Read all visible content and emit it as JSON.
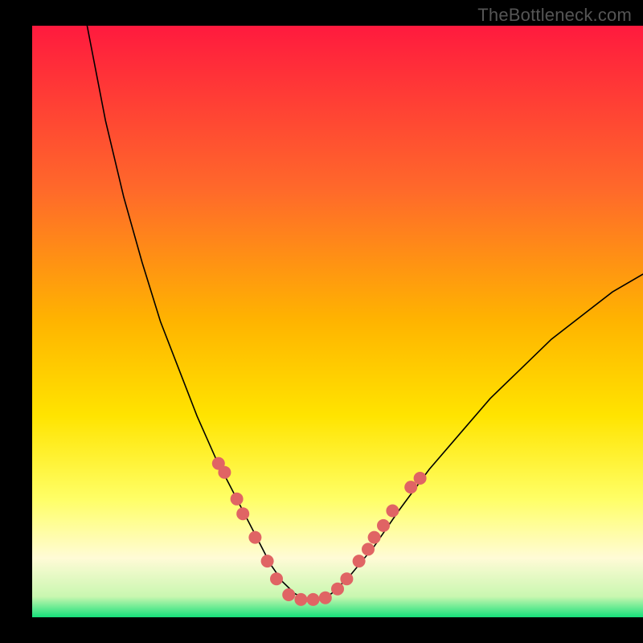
{
  "watermark": "TheBottleneck.com",
  "chart_data": {
    "type": "line",
    "title": "",
    "xlabel": "",
    "ylabel": "",
    "xlim": [
      0,
      100
    ],
    "ylim": [
      0,
      100
    ],
    "background_gradient": {
      "top": "#ff1a3e",
      "mid_upper": "#ff8a2a",
      "mid": "#ffd400",
      "mid_lower": "#ffff66",
      "cream": "#fffbd6",
      "bottom": "#15e07a"
    },
    "notes": "V-shaped curve with minimum around x≈42–48; left arm starts near top at x≈9 y≈100; right arm reaches x≈100 at y≈58. Salmon bead markers along lower portions of both arms and a short horizontal run at the floor.",
    "series": [
      {
        "name": "curve",
        "color": "#000000",
        "stroke_width": 1.6,
        "x": [
          9,
          12,
          15,
          18,
          21,
          24,
          27,
          30,
          33,
          35,
          37,
          39,
          41,
          43,
          45,
          47,
          49,
          52,
          56,
          60,
          65,
          70,
          75,
          80,
          85,
          90,
          95,
          100
        ],
        "y": [
          100,
          84,
          71,
          60,
          50,
          42,
          34,
          27,
          21,
          17,
          13,
          9,
          6,
          4,
          3,
          3,
          4,
          7,
          12,
          18,
          25,
          31,
          37,
          42,
          47,
          51,
          55,
          58
        ]
      }
    ],
    "markers": {
      "color": "#e06464",
      "radius": 8,
      "points": [
        {
          "x": 30.5,
          "y": 26
        },
        {
          "x": 31.5,
          "y": 24.5
        },
        {
          "x": 33.5,
          "y": 20
        },
        {
          "x": 34.5,
          "y": 17.5
        },
        {
          "x": 36.5,
          "y": 13.5
        },
        {
          "x": 38.5,
          "y": 9.5
        },
        {
          "x": 40,
          "y": 6.5
        },
        {
          "x": 42,
          "y": 3.8
        },
        {
          "x": 44,
          "y": 3
        },
        {
          "x": 46,
          "y": 3
        },
        {
          "x": 48,
          "y": 3.3
        },
        {
          "x": 50,
          "y": 4.8
        },
        {
          "x": 51.5,
          "y": 6.5
        },
        {
          "x": 53.5,
          "y": 9.5
        },
        {
          "x": 55,
          "y": 11.5
        },
        {
          "x": 56,
          "y": 13.5
        },
        {
          "x": 57.5,
          "y": 15.5
        },
        {
          "x": 59,
          "y": 18
        },
        {
          "x": 62,
          "y": 22
        },
        {
          "x": 63.5,
          "y": 23.5
        }
      ]
    }
  }
}
